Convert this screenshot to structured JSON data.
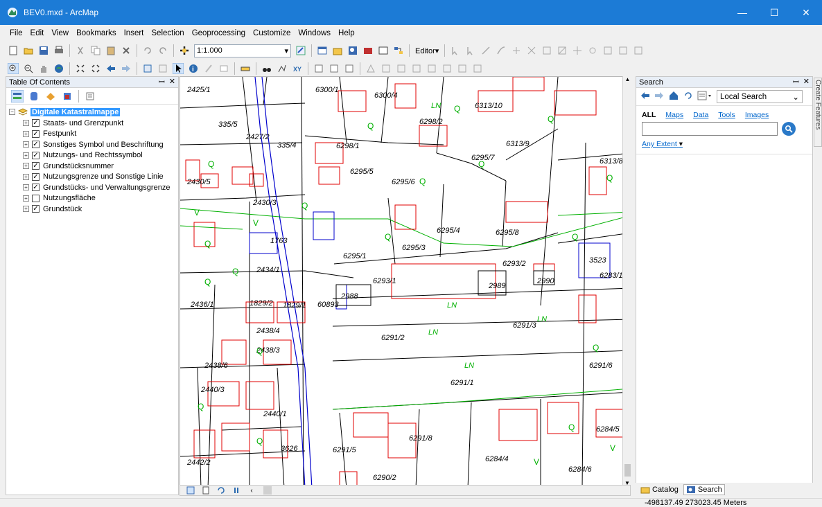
{
  "window": {
    "title": "BEV0.mxd - ArcMap",
    "minimize": "—",
    "maximize": "☐",
    "close": "✕"
  },
  "menu": [
    "File",
    "Edit",
    "View",
    "Bookmarks",
    "Insert",
    "Selection",
    "Geoprocessing",
    "Customize",
    "Windows",
    "Help"
  ],
  "toolbar": {
    "scale": "1:1.000",
    "editor_label": "Editor▾"
  },
  "toc": {
    "title": "Table Of Contents",
    "root": "Digitale Katastralmappe",
    "layers": [
      {
        "name": "Staats- und Grenzpunkt",
        "checked": true
      },
      {
        "name": "Festpunkt",
        "checked": true
      },
      {
        "name": "Sonstiges Symbol und Beschriftung",
        "checked": true
      },
      {
        "name": "Nutzungs- und Rechtssymbol",
        "checked": true
      },
      {
        "name": "Grundstücksnummer",
        "checked": true
      },
      {
        "name": "Nutzungsgrenze und Sonstige Linie",
        "checked": true
      },
      {
        "name": "Grundstücks- und Verwaltungsgrenze",
        "checked": true
      },
      {
        "name": "Nutzungsfläche",
        "checked": false
      },
      {
        "name": "Grundstück",
        "checked": true
      }
    ]
  },
  "map": {
    "labels": [
      {
        "t": "2425/1"
      },
      {
        "t": "6300/1"
      },
      {
        "t": "6300/4"
      },
      {
        "t": "6313/10"
      },
      {
        "t": "335/5"
      },
      {
        "t": "2427/2"
      },
      {
        "t": "6298/2"
      },
      {
        "t": "335/4"
      },
      {
        "t": "6298/1"
      },
      {
        "t": "6313/9"
      },
      {
        "t": "6295/7"
      },
      {
        "t": "6313/8"
      },
      {
        "t": "6295/5"
      },
      {
        "t": "6295/6"
      },
      {
        "t": "2430/5"
      },
      {
        "t": "2430/3"
      },
      {
        "t": "6295/4"
      },
      {
        "t": "6295/8"
      },
      {
        "t": "1763"
      },
      {
        "t": "6295/3"
      },
      {
        "t": "6295/1"
      },
      {
        "t": "2434/1"
      },
      {
        "t": "6293/2"
      },
      {
        "t": "3523"
      },
      {
        "t": "6293/1"
      },
      {
        "t": "2989"
      },
      {
        "t": "2990"
      },
      {
        "t": "6283/1"
      },
      {
        "t": "2988"
      },
      {
        "t": "2436/1"
      },
      {
        "t": "1829/2"
      },
      {
        "t": "1829/1"
      },
      {
        "t": "60893"
      },
      {
        "t": "6291/3"
      },
      {
        "t": "2438/4"
      },
      {
        "t": "6291/2"
      },
      {
        "t": "2438/3"
      },
      {
        "t": "2438/6"
      },
      {
        "t": "6291/6"
      },
      {
        "t": "2440/3"
      },
      {
        "t": "6291/1"
      },
      {
        "t": "2440/1"
      },
      {
        "t": "6291/8"
      },
      {
        "t": "6284/5"
      },
      {
        "t": "3626"
      },
      {
        "t": "6291/5"
      },
      {
        "t": "6284/4"
      },
      {
        "t": "2442/2"
      },
      {
        "t": "6290/2"
      },
      {
        "t": "6284/6"
      }
    ],
    "usage_labels": [
      "LN",
      "LN",
      "LN",
      "LN",
      "LN"
    ],
    "q_symbol": "Q",
    "v_symbol": "V"
  },
  "search": {
    "title": "Search",
    "mode": "Local Search",
    "tabs": [
      "ALL",
      "Maps",
      "Data",
      "Tools",
      "Images"
    ],
    "extent": "Any Extent",
    "input_value": "",
    "side_tab": "Create Features"
  },
  "footer_tabs": [
    "Catalog",
    "Search"
  ],
  "status": {
    "coords": "-498137.49  273023.45 Meters"
  },
  "colors": {
    "titlebar": "#1c7bd6",
    "selection": "#3399ff",
    "parcel_line": "#000000",
    "building_line": "#e00000",
    "usage_line": "#00b000",
    "road_line": "#0000cc"
  }
}
